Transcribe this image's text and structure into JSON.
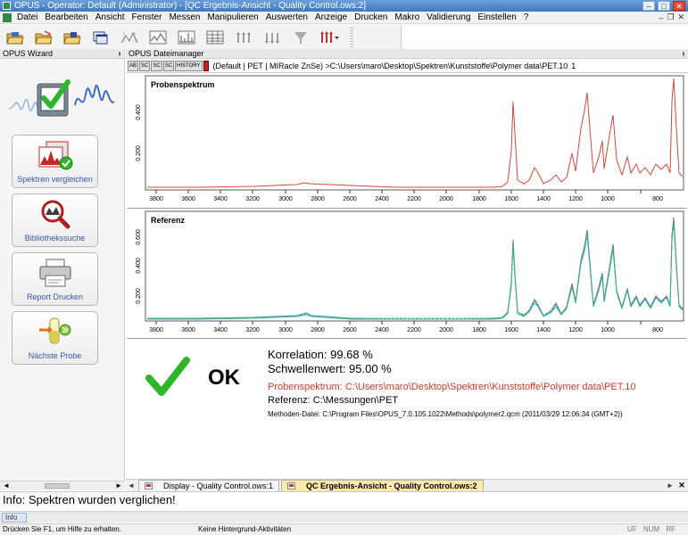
{
  "window": {
    "title": "OPUS - Operator: Default  (Administrator) - [QC Ergebnis-Ansicht - Quality Control.ows:2]",
    "min_label": "–",
    "max_label": "□",
    "close_label": "✕"
  },
  "menu": {
    "items": [
      "Datei",
      "Bearbeiten",
      "Ansicht",
      "Fenster",
      "Messen",
      "Manipulieren",
      "Auswerten",
      "Anzeige",
      "Drucken",
      "Makro",
      "Validierung",
      "Einstellen",
      "?"
    ],
    "mdi_min": "–",
    "mdi_restore": "❐",
    "mdi_close": "✕"
  },
  "toolbar": {
    "buttons": [
      "open-folder-icon",
      "open-file-icon",
      "load-folder-icon",
      "windows-icon",
      "peak-pick-icon",
      "baseline-icon",
      "spectrum-icon",
      "table-icon",
      "peak-markers-icon",
      "peak-markers-2-icon",
      "down-arrows-icon",
      "red-markers-dropdown-icon"
    ]
  },
  "wizard": {
    "header": "OPUS Wizard",
    "pin": "ᵻ",
    "buttons": [
      {
        "label": "Spektren vergleichen"
      },
      {
        "label": "Bibliothekssuche"
      },
      {
        "label": "Report Drucken"
      },
      {
        "label": "Nächste Probe"
      }
    ]
  },
  "dateimanager": {
    "header": "OPUS Dateimanager",
    "pin": "ᵻ",
    "path_buttons": [
      "AB",
      "SC",
      "SC",
      "SC",
      "HISTORY"
    ],
    "path_text": "(Default | PET | MIRacle ZnSe) >C:\\Users\\maro\\Desktop\\Spektren\\Kunststoffe\\Polymer data\\PET.10",
    "path_num": "1"
  },
  "plots": {
    "probe": {
      "title": "Probenspektrum",
      "yticks": [
        "0.400",
        "0.200"
      ],
      "xticks": [
        "3800",
        "3600",
        "3400",
        "3200",
        "3000",
        "2800",
        "2600",
        "2400",
        "2200",
        "2000",
        "1800",
        "1600",
        "1400",
        "1200",
        "1000",
        "800"
      ]
    },
    "referenz": {
      "title": "Referenz",
      "yticks": [
        "0.600",
        "0.400",
        "0.200"
      ],
      "xticks": [
        "3800",
        "3600",
        "3400",
        "3200",
        "3000",
        "2800",
        "2600",
        "2400",
        "2200",
        "2000",
        "1800",
        "1600",
        "1400",
        "1200",
        "1000",
        "800"
      ]
    }
  },
  "result": {
    "status": "OK",
    "korrelation": "Korrelation:  99.68 %",
    "schwellenwert": "Schwellenwert:  95.00 %",
    "probenspektrum": "Probenspektrum:  C:\\Users\\maro\\Desktop\\Spektren\\Kunststoffe\\Polymer data\\PET.10",
    "referenz": "Referenz:  C:\\Messungen\\PET",
    "methoden": "Methoden-Datei:  C:\\Program Files\\OPUS_7.0.105.1022\\Methods\\polymer2.qcm  (2011/03/29 12:06:34 (GMT+2))"
  },
  "tabs": {
    "left_arrow": "◄",
    "right_arrow": "►",
    "items": [
      {
        "label": "Display - Quality Control.ows:1",
        "active": false
      },
      {
        "label": "QC Ergebnis-Ansicht - Quality Control.ows:2",
        "active": true
      }
    ],
    "close": "✕"
  },
  "scroll": {
    "left_arrow": "◄",
    "right_arrow": "►"
  },
  "info": {
    "message": "Info: Spektren wurden verglichen!",
    "tab": "Info"
  },
  "status": {
    "help": "Drücken Sie F1, um Hilfe zu erhalten.",
    "background": "Keine Hintergrund-Aktivitäten",
    "flags": [
      "UF",
      "NUM",
      "RF"
    ]
  },
  "colors": {
    "probe_spectrum": "#d9463a",
    "ref_green": "#3fae3c",
    "ref_blue": "#6a5fd8",
    "ref_cyan": "#3cbfc8",
    "ok_check": "#2fb52a",
    "probe_text": "#d63a2a"
  }
}
